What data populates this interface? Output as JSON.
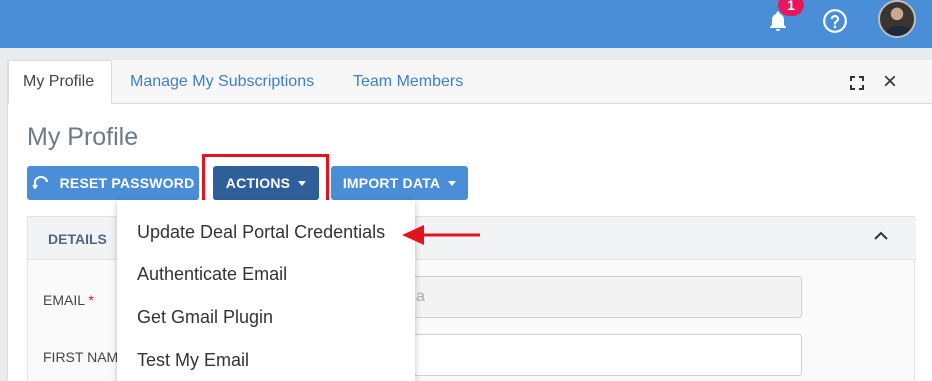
{
  "topbar": {
    "notifications_count": "1",
    "icons": [
      "bell-icon",
      "help-icon",
      "avatar"
    ]
  },
  "tabs": [
    {
      "label": "My Profile",
      "active": true
    },
    {
      "label": "Manage My Subscriptions",
      "active": false
    },
    {
      "label": "Team Members",
      "active": false
    }
  ],
  "page": {
    "title": "My Profile"
  },
  "toolbar": {
    "reset_password": "RESET PASSWORD",
    "actions": "ACTIONS",
    "import_data": "IMPORT DATA"
  },
  "details": {
    "section_label": "DETAILS",
    "email_label": "EMAIL",
    "required_mark": "*",
    "email_value_fragment": "a",
    "first_name_label": "FIRST NAM"
  },
  "actions_menu": {
    "items": [
      "Update Deal Portal Credentials",
      "Authenticate Email",
      "Get Gmail Plugin",
      "Test My Email"
    ]
  },
  "colors": {
    "topbar": "#4a8ed8",
    "actions_button": "#2f5f9a",
    "highlight": "#e0141e",
    "badge": "#e8175d"
  }
}
